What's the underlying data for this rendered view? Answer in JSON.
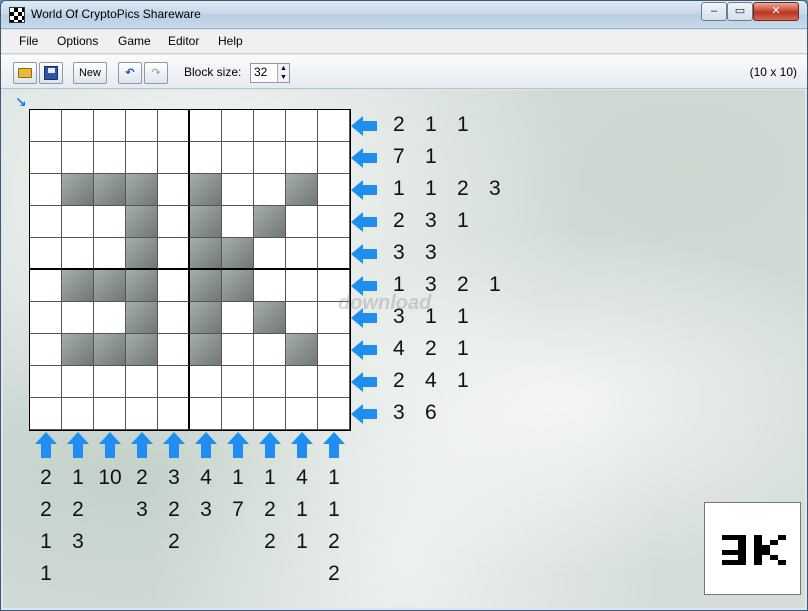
{
  "window": {
    "title": "World Of CryptoPics Shareware",
    "controls": {
      "minimize": "‒",
      "maximize": "▭",
      "close": "✕"
    }
  },
  "menu": [
    "File",
    "Options",
    "Game",
    "Editor",
    "Help"
  ],
  "toolbar": {
    "new_label": "New",
    "undo_symbol": "↶",
    "redo_symbol": "↷",
    "block_size_label": "Block size:",
    "block_size_value": "32",
    "grid_size": "(10 x 10)"
  },
  "colors": {
    "arrow": "#1f8ef0",
    "filled": "#7f8883"
  },
  "puzzle": {
    "rows": 10,
    "cols": 10,
    "filled": [
      [],
      [],
      [
        1,
        2,
        3,
        5,
        8
      ],
      [
        3,
        5,
        7
      ],
      [
        3,
        5,
        6
      ],
      [
        1,
        2,
        3,
        5,
        6
      ],
      [
        3,
        5,
        7
      ],
      [
        1,
        2,
        3,
        5,
        8
      ],
      [],
      []
    ],
    "row_clues": [
      [
        "2",
        "1",
        "1"
      ],
      [
        "7",
        "1"
      ],
      [
        "1",
        "1",
        "2",
        "3"
      ],
      [
        "2",
        "3",
        "1"
      ],
      [
        "3",
        "3"
      ],
      [
        "1",
        "3",
        "2",
        "1"
      ],
      [
        "3",
        "1",
        "1"
      ],
      [
        "4",
        "2",
        "1"
      ],
      [
        "2",
        "4",
        "1"
      ],
      [
        "3",
        "6"
      ]
    ],
    "col_clues": [
      [
        "2",
        "2",
        "1",
        "1"
      ],
      [
        "1",
        "2",
        "3"
      ],
      [
        "10"
      ],
      [
        "2",
        "3"
      ],
      [
        "3",
        "2",
        "2"
      ],
      [
        "4",
        "3"
      ],
      [
        "1",
        "7"
      ],
      [
        "1",
        "2",
        "2"
      ],
      [
        "4",
        "1",
        "1"
      ],
      [
        "1",
        "1",
        "2",
        "2"
      ]
    ]
  },
  "watermark": "download"
}
